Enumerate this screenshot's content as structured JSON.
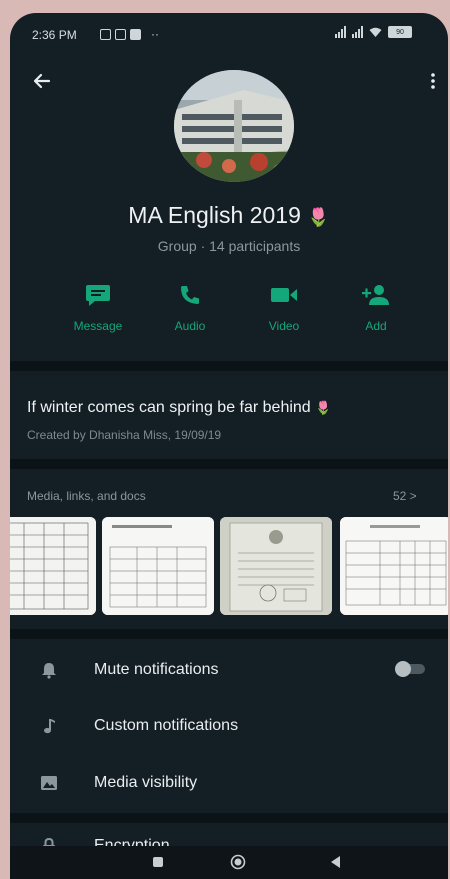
{
  "status_bar": {
    "time": "2:36 PM",
    "more": "··",
    "battery": "90"
  },
  "header": {
    "group_name": "MA English 2019",
    "group_emoji": "🌷",
    "subtitle": "Group · 14 participants"
  },
  "actions": [
    {
      "label": "Message",
      "icon": "message-icon"
    },
    {
      "label": "Audio",
      "icon": "phone-icon"
    },
    {
      "label": "Video",
      "icon": "video-camera-icon"
    },
    {
      "label": "Add",
      "icon": "add-person-icon"
    }
  ],
  "description": {
    "text": "If winter comes can spring be far behind",
    "emoji": "🌷",
    "created": "Created by Dhanisha Miss, 19/09/19"
  },
  "media": {
    "header": "Media, links, and docs",
    "count": "52 >",
    "thumbnails": [
      "document-thumbnail",
      "document-thumbnail",
      "certificate-thumbnail",
      "document-thumbnail"
    ]
  },
  "settings": [
    {
      "label": "Mute notifications",
      "icon": "bell-icon"
    },
    {
      "label": "Custom notifications",
      "icon": "music-note-icon"
    },
    {
      "label": "Media visibility",
      "icon": "image-icon"
    },
    {
      "label": "Encryption",
      "icon": "lock-icon"
    }
  ],
  "colors": {
    "accent": "#14a77a",
    "background": "#141e25",
    "divider": "#0c1317"
  }
}
